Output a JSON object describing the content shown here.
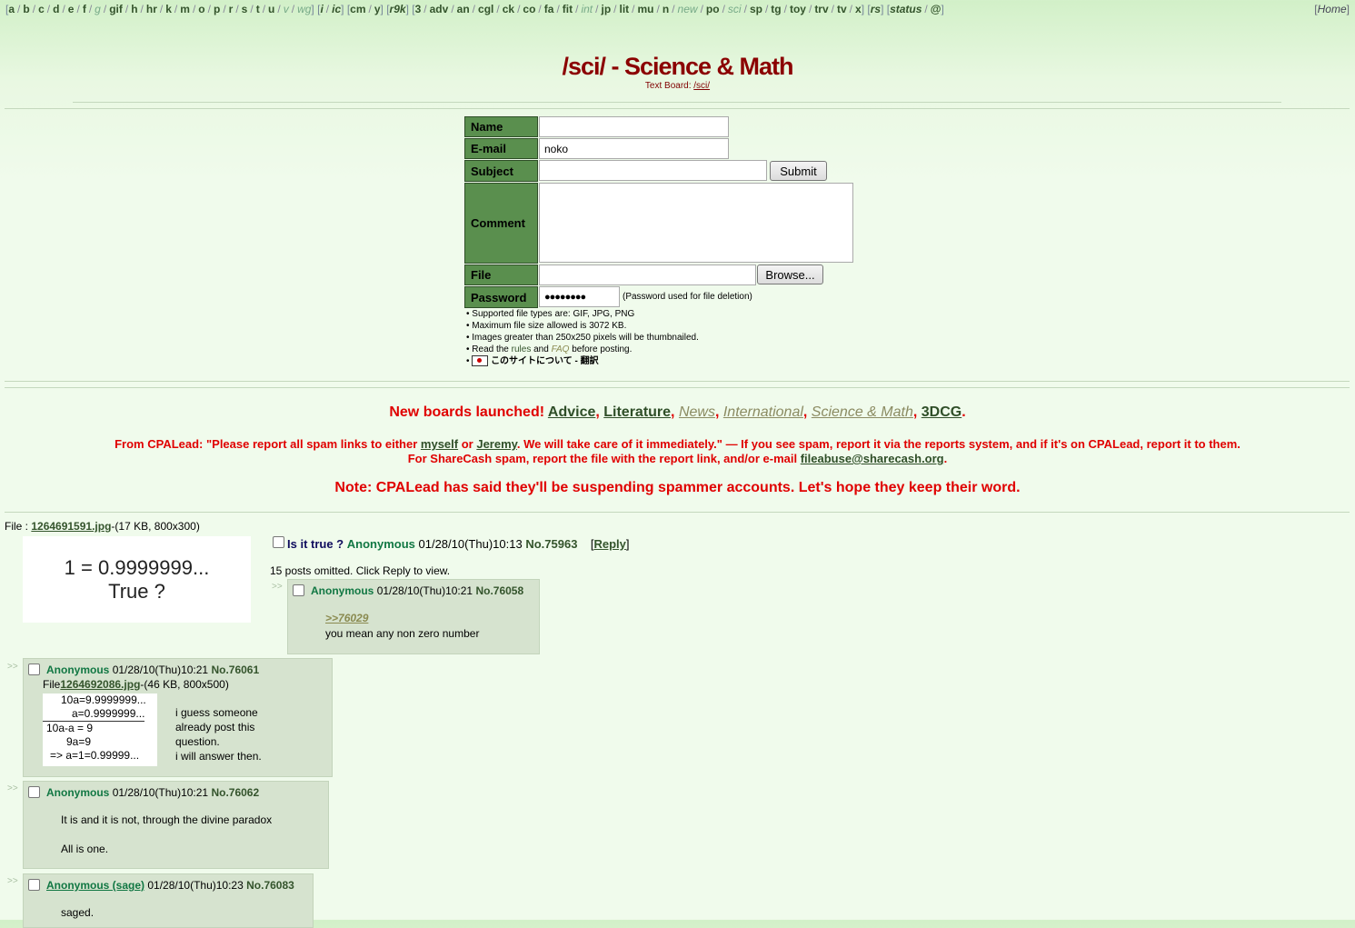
{
  "boards_nav": {
    "groups": [
      [
        "a",
        "b",
        "c",
        "d",
        "e",
        "f",
        "g",
        "gif",
        "h",
        "hr",
        "k",
        "m",
        "o",
        "p",
        "r",
        "s",
        "t",
        "u",
        "v",
        "wg"
      ],
      [
        "i",
        "ic"
      ],
      [
        "cm",
        "y"
      ],
      [
        "r9k"
      ],
      [
        "3",
        "adv",
        "an",
        "cgl",
        "ck",
        "co",
        "fa",
        "fit",
        "int",
        "jp",
        "lit",
        "mu",
        "n",
        "new",
        "po",
        "sci",
        "sp",
        "tg",
        "toy",
        "trv",
        "tv",
        "x"
      ],
      [
        "rs"
      ],
      [
        "status",
        "@"
      ]
    ],
    "home": "Home"
  },
  "header": {
    "title": "/sci/ - Science & Math",
    "subtitle_prefix": "Text Board: ",
    "subtitle_link": "/sci/"
  },
  "post_form": {
    "name_label": "Name",
    "email_label": "E-mail",
    "email_value": "noko",
    "subject_label": "Subject",
    "submit_label": "Submit",
    "comment_label": "Comment",
    "file_label": "File",
    "browse_label": "Browse...",
    "password_label": "Password",
    "password_value": "●●●●●●●●",
    "password_note": "(Password used for file deletion)",
    "rules": [
      "• Supported file types are: GIF, JPG, PNG",
      "• Maximum file size allowed is 3072 KB.",
      "• Images greater than 250x250 pixels will be thumbnailed."
    ],
    "rules_read_prefix": "• Read the ",
    "rules_link": "rules",
    "rules_and": " and ",
    "faq_link": "FAQ",
    "rules_read_suffix": " before posting.",
    "jp_link": "このサイトについて - 翻訳"
  },
  "announcements": {
    "new_boards_prefix": "New boards launched! ",
    "boards": [
      "Advice",
      "Literature",
      "News",
      "International",
      "Science & Math",
      "3DCG"
    ],
    "cpalead_1": "From CPALead: \"Please report all spam links to either ",
    "cpalead_myself": "myself",
    "cpalead_or": " or ",
    "cpalead_jeremy": "Jeremy",
    "cpalead_2": ". We will take care of it immediately.\" — If you see spam, report it via the reports system, and if it's on CPALead, report it to them.",
    "sharecash_1": "For ShareCash spam, report the file with the report link, and/or e-mail ",
    "sharecash_email": "fileabuse@sharecash.org",
    "sharecash_2": ".",
    "note": "Note: CPALead has said they'll be suspending spammer accounts. Let's hope they keep their word."
  },
  "thread": {
    "file_prefix": "File : ",
    "file_name": "1264691591.jpg",
    "file_meta": "-(17 KB, 800x300)",
    "thumb_line1": "1 = 0.9999999...",
    "thumb_line2": "True ?",
    "subject": "Is it true ?",
    "name": "Anonymous",
    "date": "01/28/10(Thu)10:13",
    "number": "No.75963",
    "reply_link": "Reply",
    "omitted": "15 posts omitted. Click Reply to view."
  },
  "replies": [
    {
      "name": "Anonymous",
      "date": "01/28/10(Thu)10:21",
      "number": "No.76058",
      "quote": ">>76029",
      "lines": [
        "you mean any non zero number"
      ]
    },
    {
      "name": "Anonymous",
      "date": "01/28/10(Thu)10:21",
      "number": "No.76061",
      "file_prefix": "File",
      "file_name": "1264692086.jpg",
      "file_meta": "-(46 KB, 800x500)",
      "thumb_lines": [
        "10a=9.9999999...",
        "a=0.9999999...",
        "10a-a = 9",
        "9a=9",
        "=>   a=1=0.99999..."
      ],
      "lines": [
        "i guess someone",
        "already post this",
        "question.",
        "i will answer then."
      ]
    },
    {
      "name": "Anonymous",
      "date": "01/28/10(Thu)10:21",
      "number": "No.76062",
      "lines": [
        "It is and it is not, through the divine paradox",
        "All is one."
      ]
    },
    {
      "name": "Anonymous (sage)",
      "date": "01/28/10(Thu)10:23",
      "number": "No.76083",
      "lines": [
        "saged."
      ]
    }
  ],
  "arrows": ">>"
}
